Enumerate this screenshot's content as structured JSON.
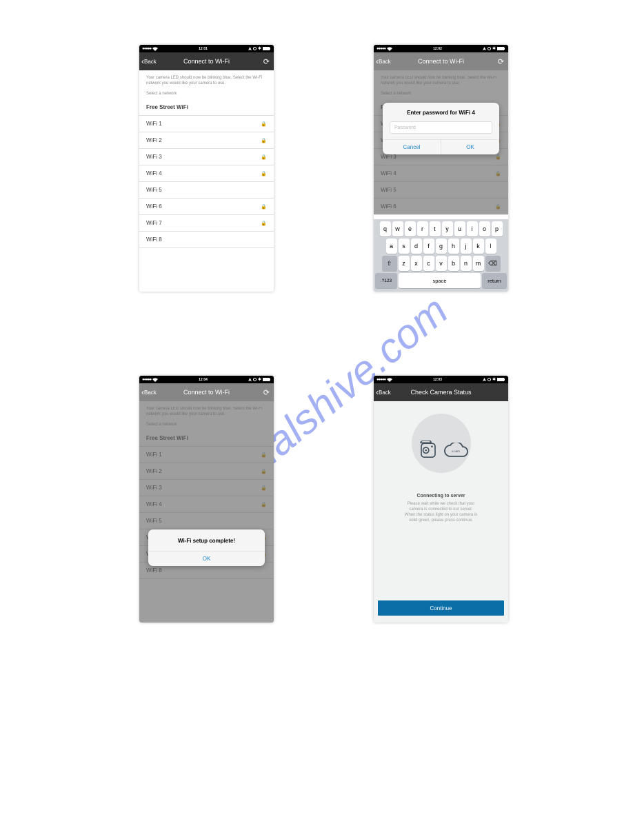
{
  "watermark": "manualshive.com",
  "status": {
    "signal": "●●●●●",
    "wifi_icon": "wifi",
    "rightIcons": "⟳ ⊘ ✱",
    "battery_icon": "battery"
  },
  "times": {
    "p1": "12:01",
    "p2": "12:02",
    "p3": "12:04",
    "p4": "12:03"
  },
  "nav": {
    "back": "Back",
    "title_wifi": "Connect to Wi-Fi",
    "title_status": "Check Camera Status"
  },
  "hint": "Your camera LED should now be blinking blue. Select the Wi-Fi network you would like your camera to use.",
  "select_label": "Select a network",
  "networks": [
    {
      "name": "Free Street WiFi",
      "locked": false,
      "bold": true
    },
    {
      "name": "WiFi 1",
      "locked": true,
      "bold": false
    },
    {
      "name": "WiFi 2",
      "locked": true,
      "bold": false
    },
    {
      "name": "WiFi 3",
      "locked": true,
      "bold": false
    },
    {
      "name": "WiFi 4",
      "locked": true,
      "bold": false
    },
    {
      "name": "WiFi 5",
      "locked": false,
      "bold": false
    },
    {
      "name": "WiFi 6",
      "locked": true,
      "bold": false
    },
    {
      "name": "WiFi 7",
      "locked": true,
      "bold": false
    },
    {
      "name": "WiFi 8",
      "locked": false,
      "bold": false
    }
  ],
  "networks_p2": [
    {
      "name": "F",
      "locked": false,
      "bold": true
    },
    {
      "name": "W",
      "locked": true,
      "bold": false
    },
    {
      "name": "W",
      "locked": true,
      "bold": false
    },
    {
      "name": "WiFi 3",
      "locked": true,
      "bold": false
    },
    {
      "name": "WiFi 4",
      "locked": true,
      "bold": false
    },
    {
      "name": "WiFi 5",
      "locked": false,
      "bold": false
    },
    {
      "name": "WiFi 6",
      "locked": true,
      "bold": false
    }
  ],
  "alert_pw": {
    "title": "Enter password for WiFi 4",
    "placeholder": "Password",
    "cancel": "Cancel",
    "ok": "OK"
  },
  "alert_done": {
    "msg": "Wi-Fi setup complete!",
    "ok": "OK"
  },
  "keyboard": {
    "row1": [
      "q",
      "w",
      "e",
      "r",
      "t",
      "y",
      "u",
      "i",
      "o",
      "p"
    ],
    "row2": [
      "a",
      "s",
      "d",
      "f",
      "g",
      "h",
      "j",
      "k",
      "l"
    ],
    "row3_shift": "⇧",
    "row3": [
      "z",
      "x",
      "c",
      "v",
      "b",
      "n",
      "m"
    ],
    "row3_del": "⌫",
    "n123": ".?123",
    "space": "space",
    "ret": "return"
  },
  "camera_status": {
    "title": "Connecting to server",
    "desc_l1": "Please wait while we check that your",
    "desc_l2": "camera is connected to our server.",
    "desc_l3": "When the status light on your camera is",
    "desc_l4": "solid green, please press continue.",
    "cloud_label": "v.cam",
    "continue": "Continue"
  }
}
